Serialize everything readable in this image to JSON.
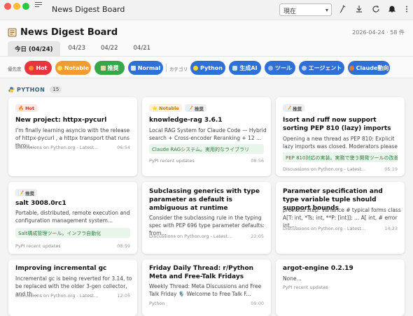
{
  "app": {
    "window_title": "News Digest Board"
  },
  "toolbar": {
    "view_select": "現在"
  },
  "header": {
    "title": "News Digest Board",
    "meta": "2026-04-24 · 58 件"
  },
  "tabs": [
    {
      "label": "今日 (04/24)",
      "active": true
    },
    {
      "label": "04/23"
    },
    {
      "label": "04/22"
    },
    {
      "label": "04/21"
    }
  ],
  "filters": {
    "priority_label": "優先度",
    "priority": [
      {
        "label": "Hot",
        "color": "#e8343c",
        "icon": "fire-icon"
      },
      {
        "label": "Notable",
        "color": "#f29b30",
        "icon": "star-icon"
      },
      {
        "label": "推奨",
        "color": "#35a84a",
        "icon": "note-icon"
      },
      {
        "label": "Normal",
        "color": "#2e6fd8",
        "icon": "doc-icon"
      }
    ],
    "category_label": "カテゴリ",
    "categories": [
      {
        "label": "Python",
        "color": "#2e6fd8",
        "icon": "python-icon"
      },
      {
        "label": "生成AI",
        "color": "#2e6fd8",
        "icon": "ai-icon"
      },
      {
        "label": "ツール",
        "color": "#2e6fd8",
        "icon": "tool-icon"
      },
      {
        "label": "エージェント",
        "color": "#2e6fd8",
        "icon": "agent-icon"
      },
      {
        "label": "Claude動向",
        "color": "#2e6fd8",
        "icon": "claude-icon"
      }
    ]
  },
  "section": {
    "title": "PYTHON",
    "count": "15"
  },
  "cards": [
    {
      "badges": [
        {
          "label": "Hot",
          "kind": "hot"
        }
      ],
      "title": "New project: httpx-pycurl",
      "desc": "I'm finally learning asyncio with the release of httpx-pycurl , a httpx transport that runs throu...",
      "source": "Discussions on Python.org - Latest...",
      "time": "06:54"
    },
    {
      "badges": [
        {
          "label": "Notable",
          "kind": "notable"
        },
        {
          "label": "推奨",
          "kind": "rec"
        }
      ],
      "title": "knowledge-rag 3.6.1",
      "desc": "Local RAG System for Claude Code — Hybrid search + Cross-encoder Reranking + 12 ...",
      "tag": "Claude RAGシステム。実用的なライブラリ",
      "source": "PyPI recent updates",
      "time": "08:56"
    },
    {
      "badges": [
        {
          "label": "推奨",
          "kind": "rec"
        }
      ],
      "title": "Isort and ruff now support sorting PEP 810 (lazy) imports",
      "desc": "Opening a new thread as PEP 810: Explicit lazy imports was closed. Moderators please move...",
      "tag": "PEP 810対応の実装。実務で使う開発ツールの改善",
      "source": "Discussions on Python.org - Latest...",
      "time": "05:19"
    },
    {
      "badges": [
        {
          "label": "推奨",
          "kind": "rec"
        }
      ],
      "title": "salt 3008.0rc1",
      "desc": "Portable, distributed, remote execution and configuration management system...",
      "tag": "Salt構成管理ツール。インフラ自動化",
      "source": "PyPI recent updates",
      "time": "08:59"
    },
    {
      "badges": [],
      "title": "Subclassing generics with type parameter as default is ambiguous at runtime",
      "desc": "Consider the subclassing rule in the typing spec with PEP 696 type parameter defaults: from...",
      "source": "Discussions on Python.org - Latest...",
      "time": "22:05"
    },
    {
      "badges": [],
      "title": "Parameter specification and type variable tuple should support bounds",
      "desc": "previous step: variance # typical forms class A[T: int, *Ts: int, **P: [int]]: ... A[ int, # error int,...",
      "source": "Discussions on Python.org - Latest...",
      "time": "14:23"
    },
    {
      "badges": [],
      "title": "Improving incremental gc",
      "desc": "Incremental gc is being reverted for 3.14, to be replaced with the older 3-gen collector, and th...",
      "source": "Discussions on Python.org - Latest...",
      "time": "12:05"
    },
    {
      "badges": [],
      "title": "Friday Daily Thread: r/Python Meta and Free-Talk Fridays",
      "desc": "Weekly Thread: Meta Discussions and Free Talk Friday 🎙️ Welcome to Free Talk F...",
      "source": "Python",
      "time": "09:00"
    },
    {
      "badges": [],
      "title": "argot-engine 0.2.19",
      "desc": "None...",
      "source": "PyPI recent updates",
      "time": ""
    }
  ]
}
